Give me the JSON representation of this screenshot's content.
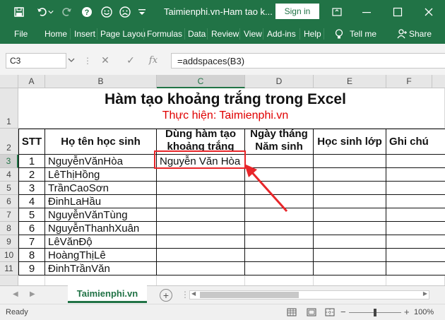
{
  "window": {
    "title": "Taimienphi.vn-Ham tao k...",
    "signin_label": "Sign in"
  },
  "ribbon": {
    "tabs": [
      "File",
      "Home",
      "Insert",
      "Page Layou",
      "Formulas",
      "Data",
      "Review",
      "View",
      "Add-ins",
      "Help"
    ],
    "tell_me": "Tell me",
    "share": "Share"
  },
  "formula_bar": {
    "name_box": "C3",
    "formula": "=addspaces(B3)",
    "cancel_icon": "✕",
    "enter_icon": "✓",
    "fx_label": "fx"
  },
  "sheet": {
    "columns": [
      "A",
      "B",
      "C",
      "D",
      "E",
      "F"
    ],
    "selected_column": "C",
    "selected_row": "3",
    "title": "Hàm tạo khoảng trắng trong Excel",
    "subtitle": "Thực hiện: Taimienphi.vn",
    "headers": {
      "stt": "STT",
      "name": "Họ tên học sinh",
      "spaces": "Dùng hàm tạo khoảng trắng",
      "dob": "Ngày tháng Năm sinh",
      "class": "Học sinh lớp",
      "note": "Ghi chú"
    },
    "row_numbers": [
      "1",
      "2",
      "3",
      "4",
      "5",
      "6",
      "7",
      "8",
      "9",
      "10",
      "11"
    ],
    "rows": [
      {
        "stt": "1",
        "name": "NguyễnVănHòa",
        "spaces": "Nguyễn Văn Hòa"
      },
      {
        "stt": "2",
        "name": "LêThịHồng",
        "spaces": ""
      },
      {
        "stt": "3",
        "name": "TrầnCaoSơn",
        "spaces": ""
      },
      {
        "stt": "4",
        "name": "ĐinhLaHầu",
        "spaces": ""
      },
      {
        "stt": "5",
        "name": "NguyễnVănTùng",
        "spaces": ""
      },
      {
        "stt": "6",
        "name": "NguyễnThanhXuân",
        "spaces": ""
      },
      {
        "stt": "7",
        "name": "LêVănĐộ",
        "spaces": ""
      },
      {
        "stt": "8",
        "name": "HoàngThịLê",
        "spaces": ""
      },
      {
        "stt": "9",
        "name": "ĐinhTrầnVăn",
        "spaces": ""
      }
    ]
  },
  "sheet_tabs": {
    "active": "Taimienphi.vn",
    "add_label": "+"
  },
  "status": {
    "ready": "Ready",
    "zoom": "100%",
    "zoom_minus": "−",
    "zoom_plus": "+"
  },
  "colors": {
    "accent": "#217346",
    "highlight_red": "#e8262a",
    "subtitle_red": "#e00000"
  }
}
